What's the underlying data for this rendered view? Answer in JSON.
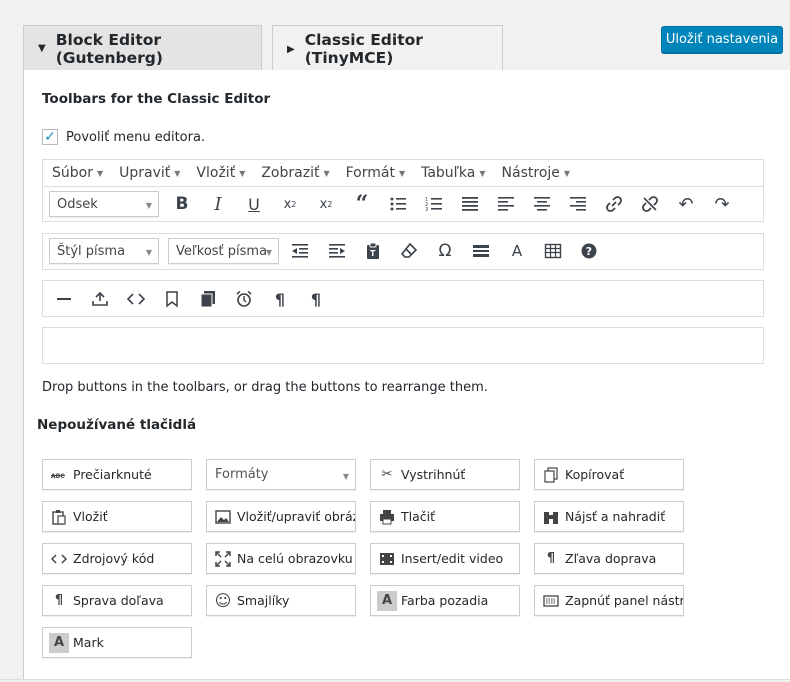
{
  "tabs": [
    {
      "label": "Block Editor (Gutenberg)",
      "icon": "triangle-down-icon"
    },
    {
      "label": "Classic Editor (TinyMCE)",
      "icon": "triangle-right-icon"
    }
  ],
  "save_button": "Uložiť nastavenia",
  "section_title": "Toolbars for the Classic Editor",
  "enable_menu": {
    "label": "Povoliť menu editora.",
    "checked": true
  },
  "menubar": [
    "Súbor",
    "Upraviť",
    "Vložiť",
    "Zobraziť",
    "Formát",
    "Tabuľka",
    "Nástroje"
  ],
  "toolbar1": {
    "format_select": "Odsek",
    "icons": [
      "bold-icon",
      "italic-icon",
      "underline-icon",
      "subscript-icon",
      "superscript-icon",
      "blockquote-icon",
      "bullet-list-icon",
      "numbered-list-icon",
      "align-justify-icon",
      "align-left-icon",
      "align-center-icon",
      "align-right-icon",
      "link-icon",
      "unlink-icon",
      "undo-icon",
      "redo-icon"
    ]
  },
  "toolbar2": {
    "font_family_select": "Štýl písma",
    "font_size_select": "Veľkosť písma",
    "icons": [
      "outdent-icon",
      "indent-icon",
      "paste-text-icon",
      "clear-formatting-icon",
      "special-character-icon",
      "horizontal-line-icon",
      "text-color-icon",
      "table-icon",
      "help-icon"
    ]
  },
  "toolbar3": {
    "icons": [
      "horizontal-rule-icon",
      "insert-icon",
      "code-icon",
      "bookmark-icon",
      "copy-icon",
      "alarm-icon",
      "paragraph-icon",
      "paragraph-alt-icon"
    ]
  },
  "hint": "Drop buttons in the toolbars, or drag the buttons to rearrange them.",
  "unused_title": "Nepoužívané tlačidlá",
  "unused_buttons": [
    {
      "label": "Prečiarknuté",
      "icon": "strikethrough-icon"
    },
    {
      "label": "Formáty",
      "icon": "select-caret-icon"
    },
    {
      "label": "Vystrihnúť",
      "icon": "scissors-icon"
    },
    {
      "label": "Kopírovať",
      "icon": "copy-icon"
    },
    {
      "label": "Vložiť",
      "icon": "paste-icon"
    },
    {
      "label": "Vložiť/upraviť obráz...",
      "icon": "image-icon"
    },
    {
      "label": "Tlačiť",
      "icon": "print-icon"
    },
    {
      "label": "Nájsť a nahradiť",
      "icon": "binoculars-icon"
    },
    {
      "label": "Zdrojový kód",
      "icon": "code-icon"
    },
    {
      "label": "Na celú obrazovku",
      "icon": "fullscreen-icon"
    },
    {
      "label": "Insert/edit video",
      "icon": "video-icon"
    },
    {
      "label": "Zľava doprava",
      "icon": "ltr-icon"
    },
    {
      "label": "Sprava doľava",
      "icon": "rtl-icon"
    },
    {
      "label": "Smajlíky",
      "icon": "smiley-icon"
    },
    {
      "label": "Farba pozadia",
      "icon": "background-color-icon"
    },
    {
      "label": "Zapnúť panel nástro...",
      "icon": "toolbar-toggle-icon"
    },
    {
      "label": "Mark",
      "icon": "mark-icon"
    }
  ]
}
